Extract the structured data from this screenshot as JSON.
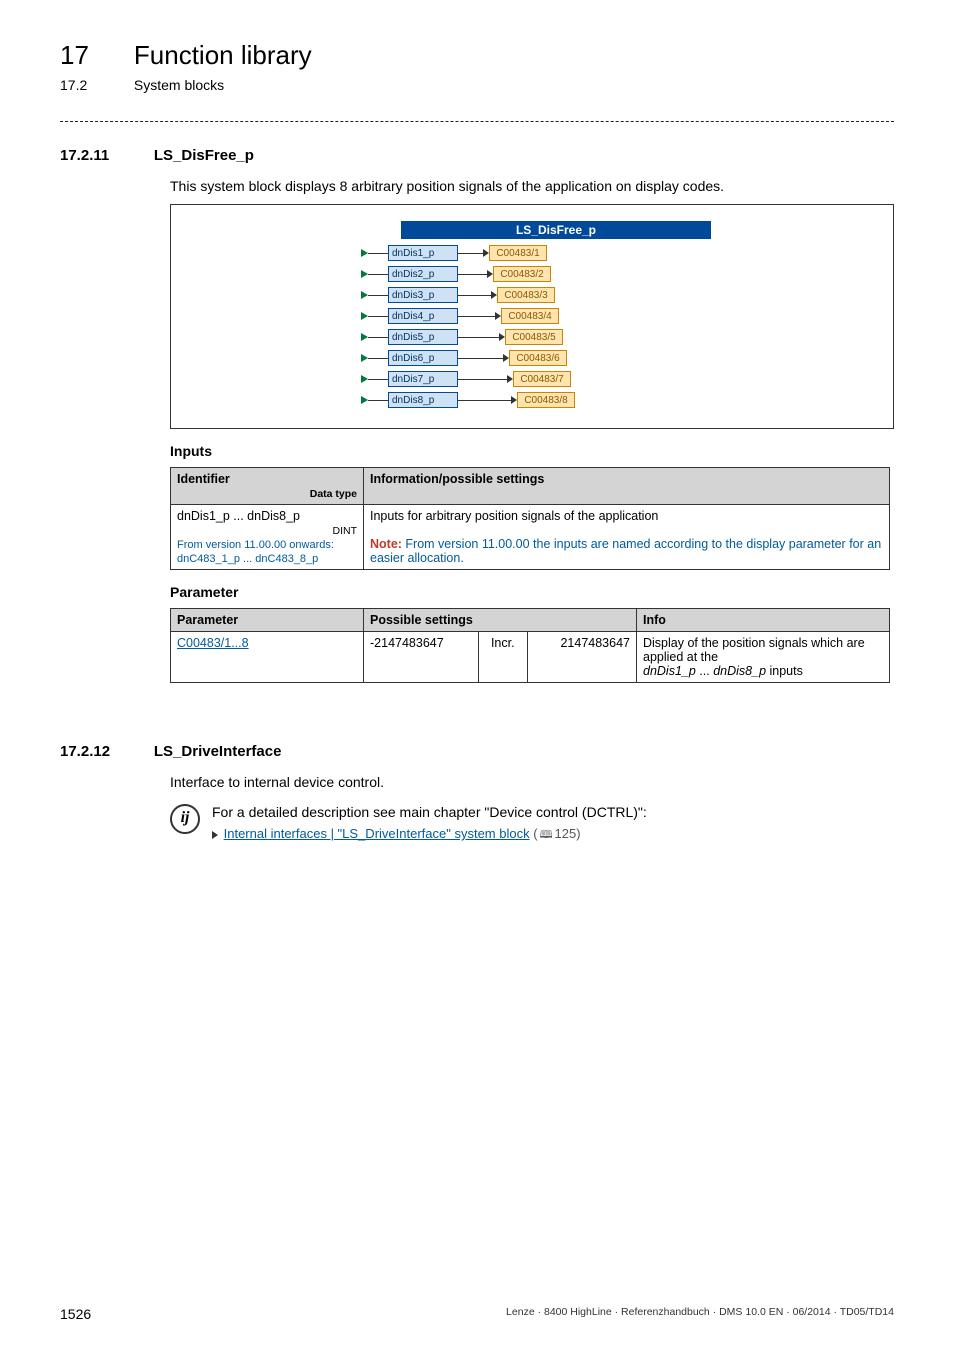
{
  "chapter": {
    "num": "17",
    "title": "Function library"
  },
  "subsection": {
    "num": "17.2",
    "title": "System blocks"
  },
  "sec1": {
    "num": "17.2.11",
    "title": "LS_DisFree_p",
    "desc": "This system block displays 8 arbitrary position signals of the application on display codes.",
    "banner": "LS_DisFree_p",
    "ports": [
      {
        "name": "dnDis1_p",
        "code": "C00483/1"
      },
      {
        "name": "dnDis2_p",
        "code": "C00483/2"
      },
      {
        "name": "dnDis3_p",
        "code": "C00483/3"
      },
      {
        "name": "dnDis4_p",
        "code": "C00483/4"
      },
      {
        "name": "dnDis5_p",
        "code": "C00483/5"
      },
      {
        "name": "dnDis6_p",
        "code": "C00483/6"
      },
      {
        "name": "dnDis7_p",
        "code": "C00483/7"
      },
      {
        "name": "dnDis8_p",
        "code": "C00483/8"
      }
    ],
    "inputs_heading": "Inputs",
    "inputs_table": {
      "h1": "Identifier",
      "h1_sub": "Data type",
      "h2": "Information/possible settings",
      "row1_var": "dnDis1_p ... dnDis8_p",
      "row1_dtype": "DINT",
      "row1_note_a": "From version 11.00.00 onwards:",
      "row1_note_b": "dnC483_1_p ... dnC483_8_p",
      "row1_desc1": "Inputs for arbitrary position signals of the application",
      "row1_desc2a": "Note:",
      "row1_desc2b": " From version 11.00.00 the inputs are named according to the display parameter for an easier allocation."
    },
    "params_heading": "Parameter",
    "params_table": {
      "h1": "Parameter",
      "h2": "Possible settings",
      "h3": "Info",
      "row1_param": "C00483/1...8",
      "row1_min": "-2147483647",
      "row1_step": "Incr.",
      "row1_max": "2147483647",
      "row1_info": "Display of the position signals which are applied at the\ndnDis1_p ... dnDis8_p inputs"
    }
  },
  "sec2": {
    "num": "17.2.12",
    "title": "LS_DriveInterface",
    "desc": "Interface to internal device control.",
    "tip_text": "For a detailed description see main chapter \"Device control (DCTRL)\":",
    "tip_link": "Internal interfaces | \"LS_DriveInterface\" system block",
    "tip_page": "125"
  },
  "footer": {
    "pagenum": "1526",
    "right": "Lenze · 8400 HighLine · Referenzhandbuch · DMS 10.0 EN · 06/2014 · TD05/TD14"
  }
}
